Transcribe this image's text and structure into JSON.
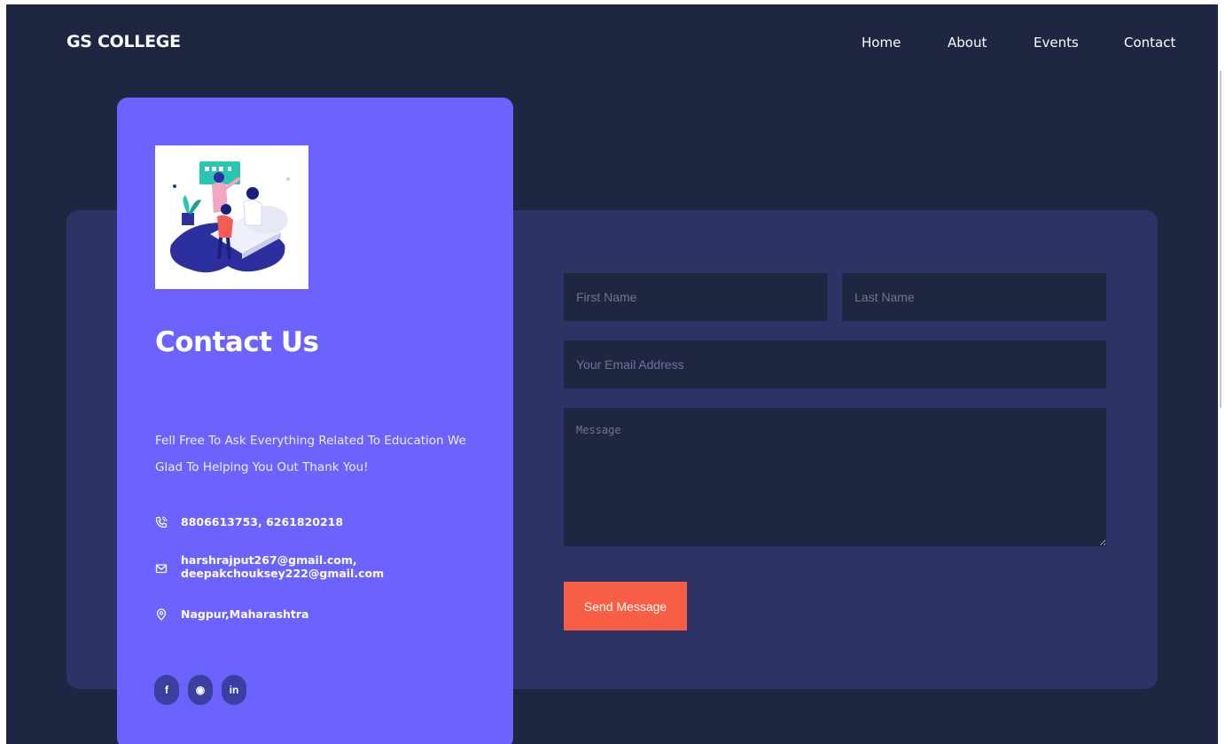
{
  "header": {
    "brand": "GS COLLEGE",
    "nav": [
      "Home",
      "About",
      "Events",
      "Contact"
    ]
  },
  "contact_card": {
    "title": "Contact Us",
    "description": "Fell Free To Ask Everything Related To Education We Glad To Helping You Out Thank You!",
    "phone": "8806613753, 6261820218",
    "email_line1": "harshrajput267@gmail.com,",
    "email_line2": "deepakchouksey222@gmail.com",
    "location": "Nagpur,Maharashtra",
    "socials": [
      {
        "icon": "facebook-icon",
        "glyph": "f"
      },
      {
        "icon": "instagram-icon",
        "glyph": "◉"
      },
      {
        "icon": "linkedin-icon",
        "glyph": "in"
      }
    ]
  },
  "form": {
    "first_name_placeholder": "First Name",
    "last_name_placeholder": "Last Name",
    "email_placeholder": "Your Email Address",
    "message_placeholder": "Message",
    "submit_label": "Send Message"
  },
  "colors": {
    "background": "#1f2642",
    "panel": "#2e3365",
    "card": "#6c63ff",
    "button": "#f85e45"
  }
}
